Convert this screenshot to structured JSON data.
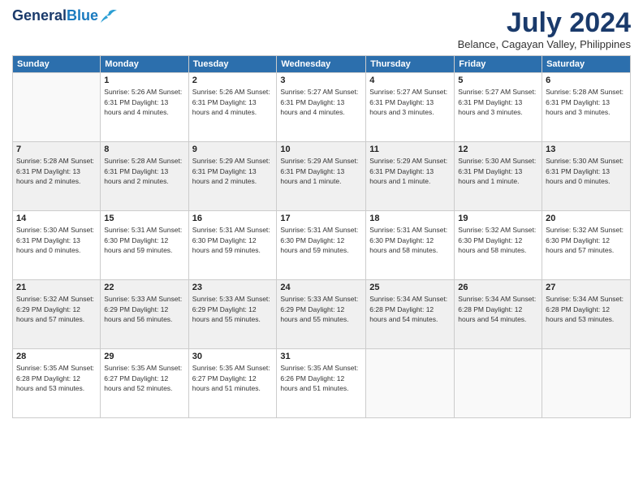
{
  "header": {
    "logo_line1": "General",
    "logo_line2": "Blue",
    "month_year": "July 2024",
    "location": "Belance, Cagayan Valley, Philippines"
  },
  "days_of_week": [
    "Sunday",
    "Monday",
    "Tuesday",
    "Wednesday",
    "Thursday",
    "Friday",
    "Saturday"
  ],
  "weeks": [
    [
      {
        "day": "",
        "info": ""
      },
      {
        "day": "1",
        "info": "Sunrise: 5:26 AM\nSunset: 6:31 PM\nDaylight: 13 hours\nand 4 minutes."
      },
      {
        "day": "2",
        "info": "Sunrise: 5:26 AM\nSunset: 6:31 PM\nDaylight: 13 hours\nand 4 minutes."
      },
      {
        "day": "3",
        "info": "Sunrise: 5:27 AM\nSunset: 6:31 PM\nDaylight: 13 hours\nand 4 minutes."
      },
      {
        "day": "4",
        "info": "Sunrise: 5:27 AM\nSunset: 6:31 PM\nDaylight: 13 hours\nand 3 minutes."
      },
      {
        "day": "5",
        "info": "Sunrise: 5:27 AM\nSunset: 6:31 PM\nDaylight: 13 hours\nand 3 minutes."
      },
      {
        "day": "6",
        "info": "Sunrise: 5:28 AM\nSunset: 6:31 PM\nDaylight: 13 hours\nand 3 minutes."
      }
    ],
    [
      {
        "day": "7",
        "info": "Sunrise: 5:28 AM\nSunset: 6:31 PM\nDaylight: 13 hours\nand 2 minutes."
      },
      {
        "day": "8",
        "info": "Sunrise: 5:28 AM\nSunset: 6:31 PM\nDaylight: 13 hours\nand 2 minutes."
      },
      {
        "day": "9",
        "info": "Sunrise: 5:29 AM\nSunset: 6:31 PM\nDaylight: 13 hours\nand 2 minutes."
      },
      {
        "day": "10",
        "info": "Sunrise: 5:29 AM\nSunset: 6:31 PM\nDaylight: 13 hours\nand 1 minute."
      },
      {
        "day": "11",
        "info": "Sunrise: 5:29 AM\nSunset: 6:31 PM\nDaylight: 13 hours\nand 1 minute."
      },
      {
        "day": "12",
        "info": "Sunrise: 5:30 AM\nSunset: 6:31 PM\nDaylight: 13 hours\nand 1 minute."
      },
      {
        "day": "13",
        "info": "Sunrise: 5:30 AM\nSunset: 6:31 PM\nDaylight: 13 hours\nand 0 minutes."
      }
    ],
    [
      {
        "day": "14",
        "info": "Sunrise: 5:30 AM\nSunset: 6:31 PM\nDaylight: 13 hours\nand 0 minutes."
      },
      {
        "day": "15",
        "info": "Sunrise: 5:31 AM\nSunset: 6:30 PM\nDaylight: 12 hours\nand 59 minutes."
      },
      {
        "day": "16",
        "info": "Sunrise: 5:31 AM\nSunset: 6:30 PM\nDaylight: 12 hours\nand 59 minutes."
      },
      {
        "day": "17",
        "info": "Sunrise: 5:31 AM\nSunset: 6:30 PM\nDaylight: 12 hours\nand 59 minutes."
      },
      {
        "day": "18",
        "info": "Sunrise: 5:31 AM\nSunset: 6:30 PM\nDaylight: 12 hours\nand 58 minutes."
      },
      {
        "day": "19",
        "info": "Sunrise: 5:32 AM\nSunset: 6:30 PM\nDaylight: 12 hours\nand 58 minutes."
      },
      {
        "day": "20",
        "info": "Sunrise: 5:32 AM\nSunset: 6:30 PM\nDaylight: 12 hours\nand 57 minutes."
      }
    ],
    [
      {
        "day": "21",
        "info": "Sunrise: 5:32 AM\nSunset: 6:29 PM\nDaylight: 12 hours\nand 57 minutes."
      },
      {
        "day": "22",
        "info": "Sunrise: 5:33 AM\nSunset: 6:29 PM\nDaylight: 12 hours\nand 56 minutes."
      },
      {
        "day": "23",
        "info": "Sunrise: 5:33 AM\nSunset: 6:29 PM\nDaylight: 12 hours\nand 55 minutes."
      },
      {
        "day": "24",
        "info": "Sunrise: 5:33 AM\nSunset: 6:29 PM\nDaylight: 12 hours\nand 55 minutes."
      },
      {
        "day": "25",
        "info": "Sunrise: 5:34 AM\nSunset: 6:28 PM\nDaylight: 12 hours\nand 54 minutes."
      },
      {
        "day": "26",
        "info": "Sunrise: 5:34 AM\nSunset: 6:28 PM\nDaylight: 12 hours\nand 54 minutes."
      },
      {
        "day": "27",
        "info": "Sunrise: 5:34 AM\nSunset: 6:28 PM\nDaylight: 12 hours\nand 53 minutes."
      }
    ],
    [
      {
        "day": "28",
        "info": "Sunrise: 5:35 AM\nSunset: 6:28 PM\nDaylight: 12 hours\nand 53 minutes."
      },
      {
        "day": "29",
        "info": "Sunrise: 5:35 AM\nSunset: 6:27 PM\nDaylight: 12 hours\nand 52 minutes."
      },
      {
        "day": "30",
        "info": "Sunrise: 5:35 AM\nSunset: 6:27 PM\nDaylight: 12 hours\nand 51 minutes."
      },
      {
        "day": "31",
        "info": "Sunrise: 5:35 AM\nSunset: 6:26 PM\nDaylight: 12 hours\nand 51 minutes."
      },
      {
        "day": "",
        "info": ""
      },
      {
        "day": "",
        "info": ""
      },
      {
        "day": "",
        "info": ""
      }
    ]
  ]
}
